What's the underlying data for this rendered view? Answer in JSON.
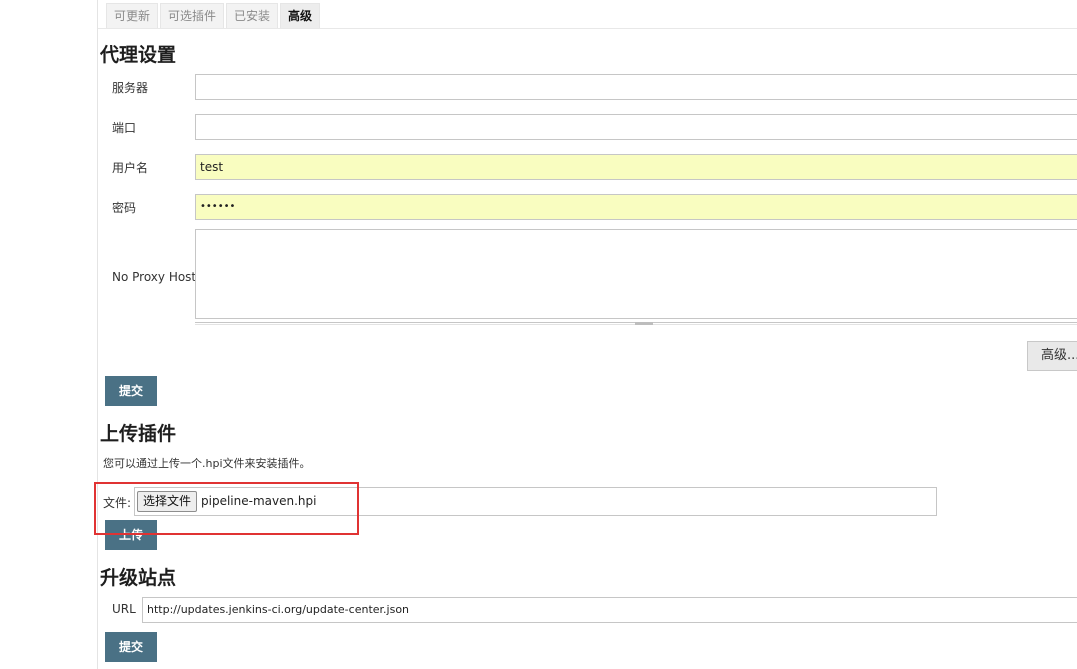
{
  "tabs": [
    {
      "label": "可更新",
      "active": false
    },
    {
      "label": "可选插件",
      "active": false
    },
    {
      "label": "已安装",
      "active": false
    },
    {
      "label": "高级",
      "active": true
    }
  ],
  "proxy": {
    "title": "代理设置",
    "server_label": "服务器",
    "server_value": "",
    "port_label": "端口",
    "port_value": "",
    "username_label": "用户名",
    "username_value": "test",
    "password_label": "密码",
    "password_value": "••••••",
    "no_proxy_label": "No Proxy Host",
    "no_proxy_value": "",
    "advanced_label": "高级...",
    "submit_label": "提交"
  },
  "upload": {
    "title": "上传插件",
    "description": "您可以通过上传一个.hpi文件来安装插件。",
    "file_label": "文件:",
    "choose_file_label": "选择文件",
    "file_name": "pipeline-maven.hpi",
    "upload_label": "上传"
  },
  "update_site": {
    "title": "升级站点",
    "url_label": "URL",
    "url_value": "http://updates.jenkins-ci.org/update-center.json",
    "submit_label": "提交"
  },
  "colors": {
    "primary_button": "#4a7185",
    "autofill_background": "#f9fdc0",
    "highlight": "#e03333"
  }
}
